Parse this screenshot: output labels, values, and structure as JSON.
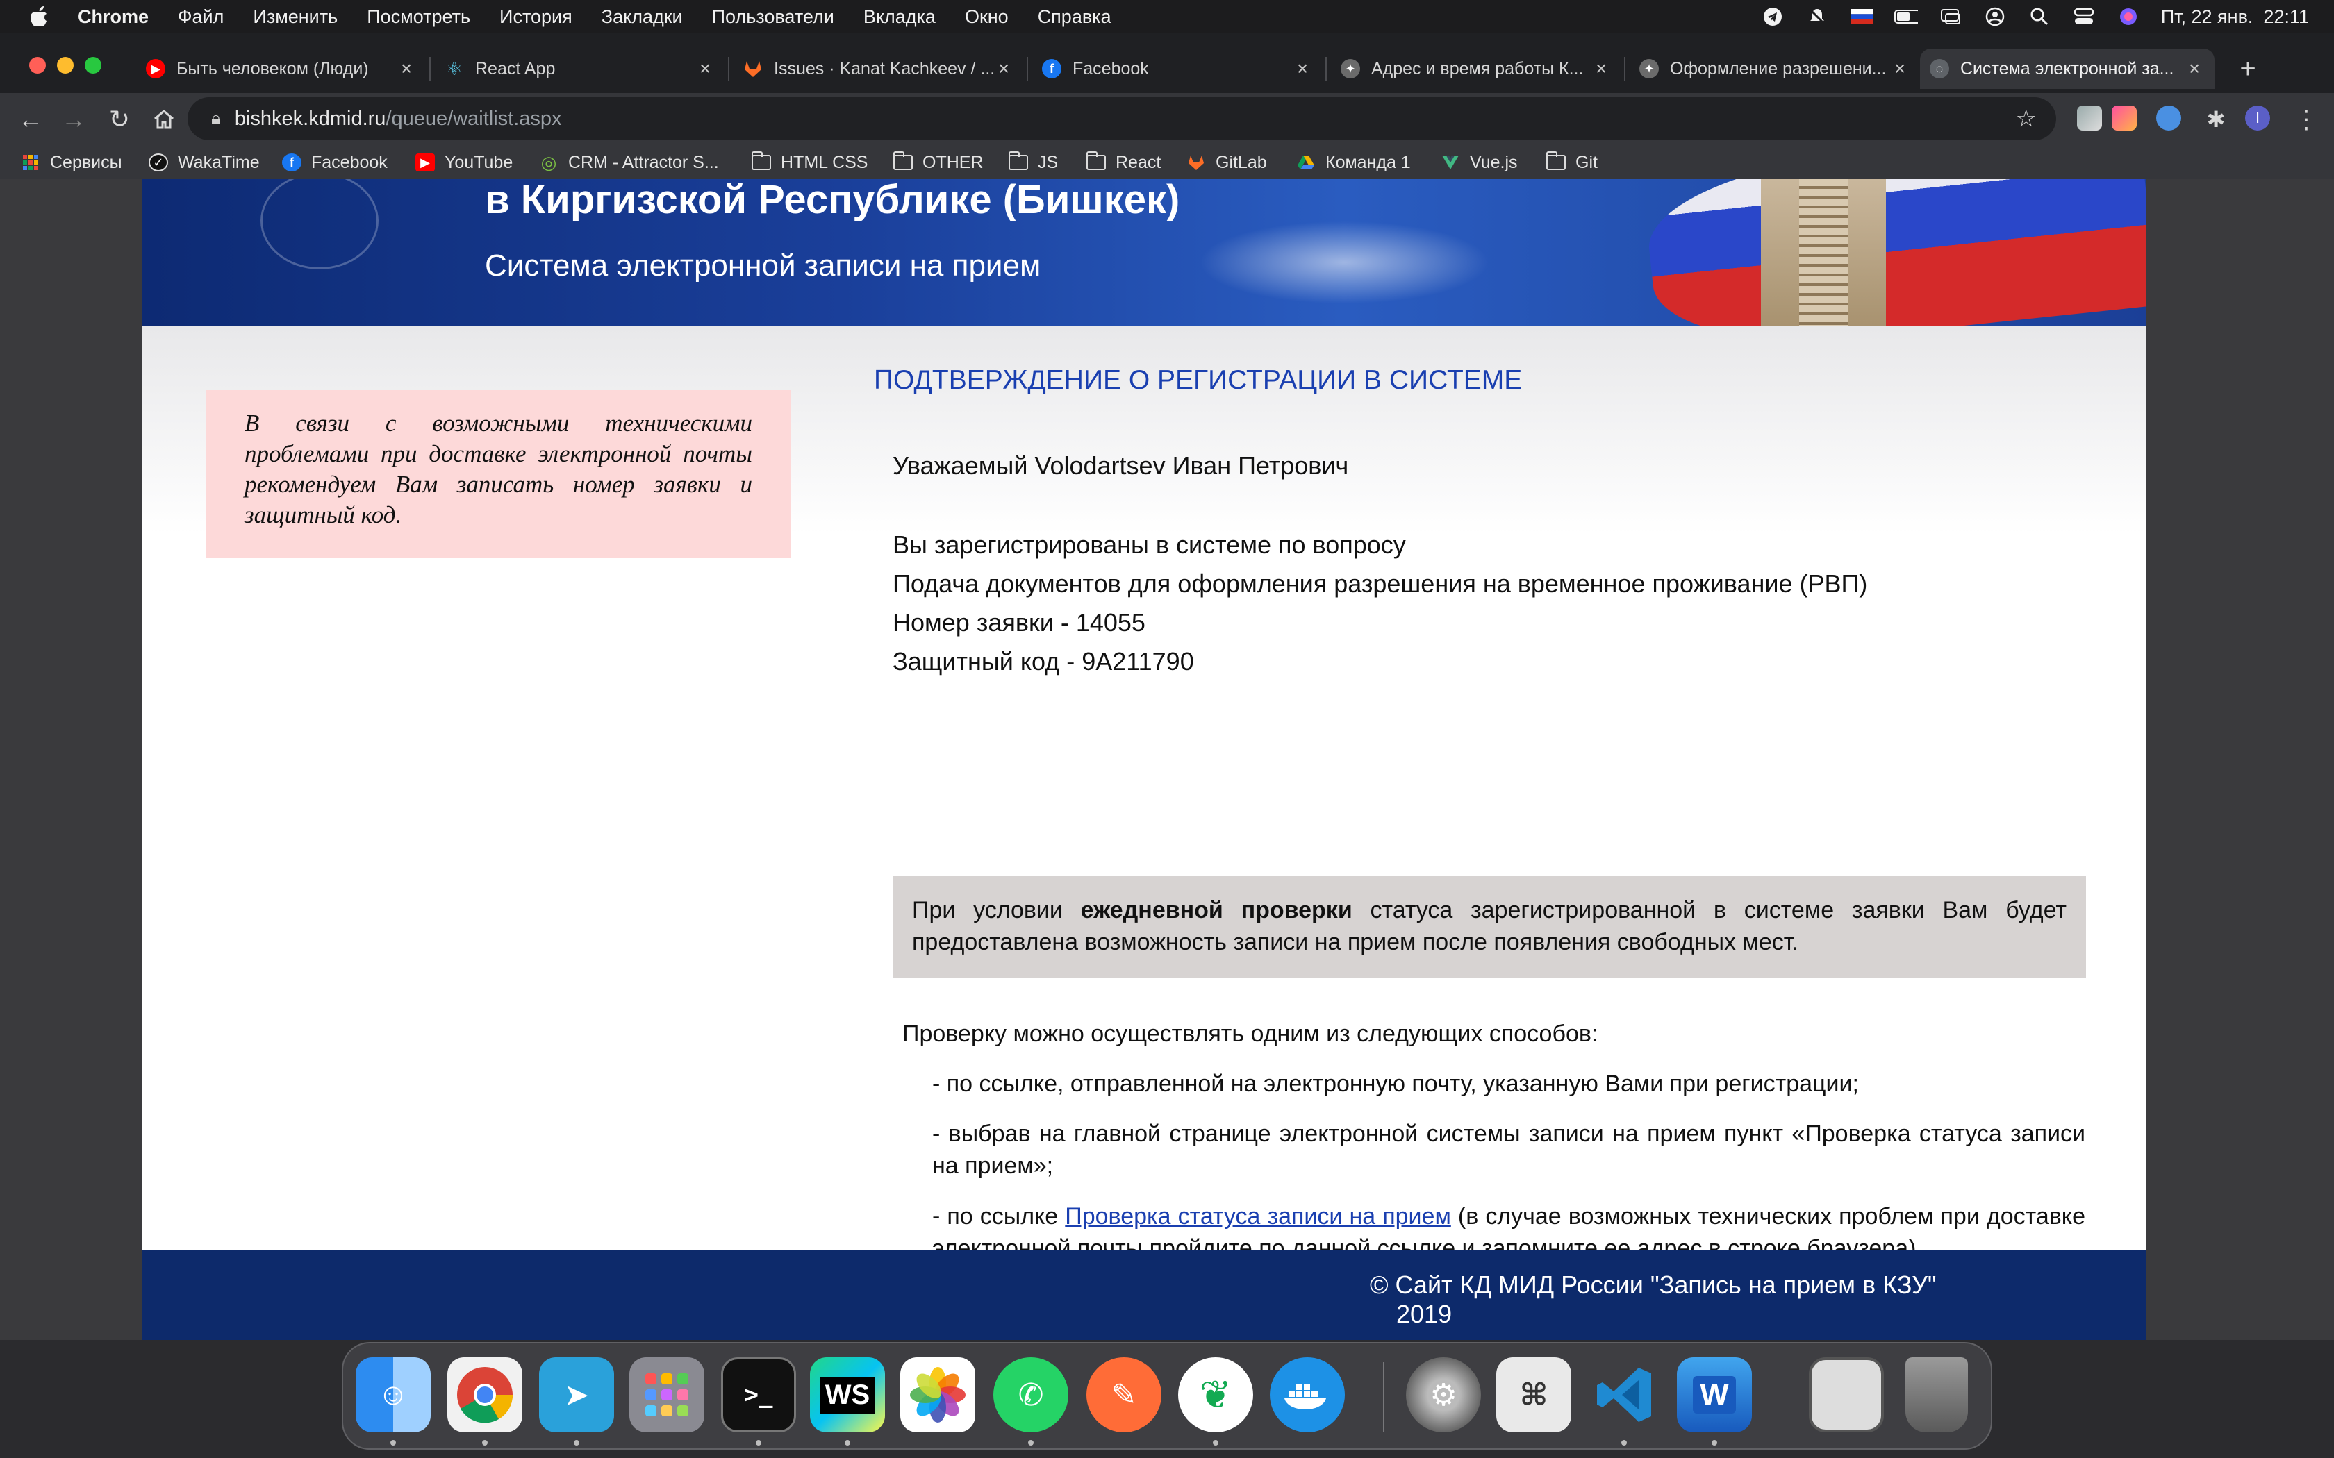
{
  "menubar": {
    "app": "Chrome",
    "items": [
      "Файл",
      "Изменить",
      "Посмотреть",
      "История",
      "Закладки",
      "Пользователи",
      "Вкладка",
      "Окно",
      "Справка"
    ],
    "datetime": "Пт, 22 янв.  22:11"
  },
  "tabs": [
    {
      "title": "Быть человеком (Люди)",
      "icon": "youtube-icon",
      "color": "#ff0000"
    },
    {
      "title": "React App",
      "icon": "react-icon",
      "color": "#61dafb"
    },
    {
      "title": "Issues · Kanat Kachkeev / ...",
      "icon": "gitlab-icon",
      "color": "#fc6d26"
    },
    {
      "title": "Facebook",
      "icon": "facebook-icon",
      "color": "#1877f2"
    },
    {
      "title": "Адрес и время работы К...",
      "icon": "emblem-icon",
      "color": "#888888"
    },
    {
      "title": "Оформление разрешени...",
      "icon": "emblem-icon",
      "color": "#888888"
    },
    {
      "title": "Система электронной за...",
      "icon": "globe-icon",
      "color": "#888888"
    }
  ],
  "address": {
    "host": "bishkek.kdmid.ru",
    "path": "/queue/waitlist.aspx"
  },
  "bookmarks": [
    "Сервисы",
    "WakaTime",
    "Facebook",
    "YouTube",
    "CRM - Attractor S...",
    "HTML CSS",
    "OTHER",
    "JS",
    "React",
    "GitLab",
    "Команда 1",
    "Vue.js",
    "Git"
  ],
  "profile_initial": "I",
  "page": {
    "banner_line1": "в Киргизской Республике (Бишкек)",
    "banner_line2": "Система электронной записи на прием",
    "notice": "В связи с возможными техническими проблемами при доставке электронной почты рекомендуем Вам записать номер заявки и защитный код.",
    "heading": "ПОДТВЕРЖДЕНИЕ О РЕГИСТРАЦИИ В СИСТЕМЕ",
    "greeting": "Уважаемый Volodartsev Иван Петрович",
    "registered": "Вы зарегистрированы в системе по вопросу",
    "service": "Подача документов для оформления разрешения на временное проживание (РВП)",
    "application_number": "Номер заявки - 14055",
    "security_code": "Защитный код - 9A211790",
    "info_prefix": "При условии",
    "info_bold": "ежедневной проверки",
    "info_suffix": "статуса зарегистрированной в системе заявки Вам будет предоставлена возможность записи на прием после появления свободных мест.",
    "methods_intro": "Проверку можно осуществлять одним из следующих способов:",
    "method1": "- по ссылке, отправленной на электронную почту, указанную Вами при регистрации;",
    "method2": "- выбрав на главной странице электронной системы записи на прием пункт «Проверка статуса записи на прием»;",
    "method3_prefix": "- по ссылке",
    "method3_link": "Проверка статуса записи на прием",
    "method3_suffix": "(в случае возможных технических проблем при доставке электронной почты пройдите по данной ссылке и запомните ее адрес в строке браузера).",
    "footer_line1": "© Сайт КД МИД России \"Запись на прием в КЗУ\"",
    "footer_line2": "2019"
  },
  "dock_labels": {
    "webstorm": "WS",
    "terminal": ">_",
    "word": "W"
  }
}
